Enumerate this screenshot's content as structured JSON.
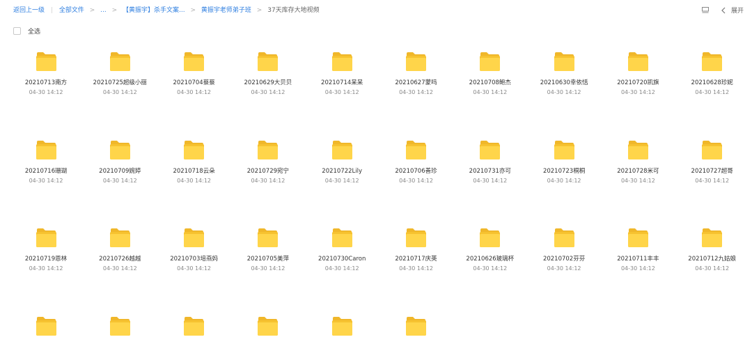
{
  "breadcrumb": {
    "back": "返回上一级",
    "items": [
      "全部文件",
      "...",
      "【黄振宇】杀手文案...",
      "黄振宇老师弟子班",
      "37天库存大地视频"
    ]
  },
  "toolbar": {
    "expand_label": "展开"
  },
  "selection": {
    "select_all_label": "全选"
  },
  "folders": [
    {
      "name": "20210713南方",
      "date": "04-30 14:12"
    },
    {
      "name": "20210725超级小丽",
      "date": "04-30 14:12"
    },
    {
      "name": "20210704蔡蔡",
      "date": "04-30 14:12"
    },
    {
      "name": "20210629大贝贝",
      "date": "04-30 14:12"
    },
    {
      "name": "20210714呆呆",
      "date": "04-30 14:12"
    },
    {
      "name": "20210627蒙吗",
      "date": "04-30 14:12"
    },
    {
      "name": "20210708鲍杰",
      "date": "04-30 14:12"
    },
    {
      "name": "20210630幸依恬",
      "date": "04-30 14:12"
    },
    {
      "name": "20210720凯旗",
      "date": "04-30 14:12"
    },
    {
      "name": "20210628珍妮",
      "date": "04-30 14:12"
    },
    {
      "name": "20210716珊瑚",
      "date": "04-30 14:12"
    },
    {
      "name": "20210709婉婷",
      "date": "04-30 14:12"
    },
    {
      "name": "20210718云朵",
      "date": "04-30 14:12"
    },
    {
      "name": "20210729宛宁",
      "date": "04-30 14:12"
    },
    {
      "name": "20210722Lily",
      "date": "04-30 14:12"
    },
    {
      "name": "20210706善珍",
      "date": "04-30 14:12"
    },
    {
      "name": "20210731亦可",
      "date": "04-30 14:12"
    },
    {
      "name": "20210723桐桐",
      "date": "04-30 14:12"
    },
    {
      "name": "20210728米可",
      "date": "04-30 14:12"
    },
    {
      "name": "20210727超哥",
      "date": "04-30 14:12"
    },
    {
      "name": "20210719恩林",
      "date": "04-30 14:12"
    },
    {
      "name": "20210726越越",
      "date": "04-30 14:12"
    },
    {
      "name": "20210703培燕妈",
      "date": "04-30 14:12"
    },
    {
      "name": "20210705美萍",
      "date": "04-30 14:12"
    },
    {
      "name": "20210730Caron",
      "date": "04-30 14:12"
    },
    {
      "name": "20210717庆英",
      "date": "04-30 14:12"
    },
    {
      "name": "20210626玻璃杯",
      "date": "04-30 14:12"
    },
    {
      "name": "20210702芬芬",
      "date": "04-30 14:12"
    },
    {
      "name": "20210711丰丰",
      "date": "04-30 14:12"
    },
    {
      "name": "20210712九姑娘",
      "date": "04-30 14:12"
    },
    {
      "name": "",
      "date": ""
    },
    {
      "name": "",
      "date": ""
    },
    {
      "name": "",
      "date": ""
    },
    {
      "name": "",
      "date": ""
    },
    {
      "name": "",
      "date": ""
    },
    {
      "name": "",
      "date": ""
    }
  ],
  "colors": {
    "link": "#2f7fe0",
    "folder_back": "#f6c230",
    "folder_front": "#ffd54a",
    "folder_tab": "#f0b72a"
  }
}
